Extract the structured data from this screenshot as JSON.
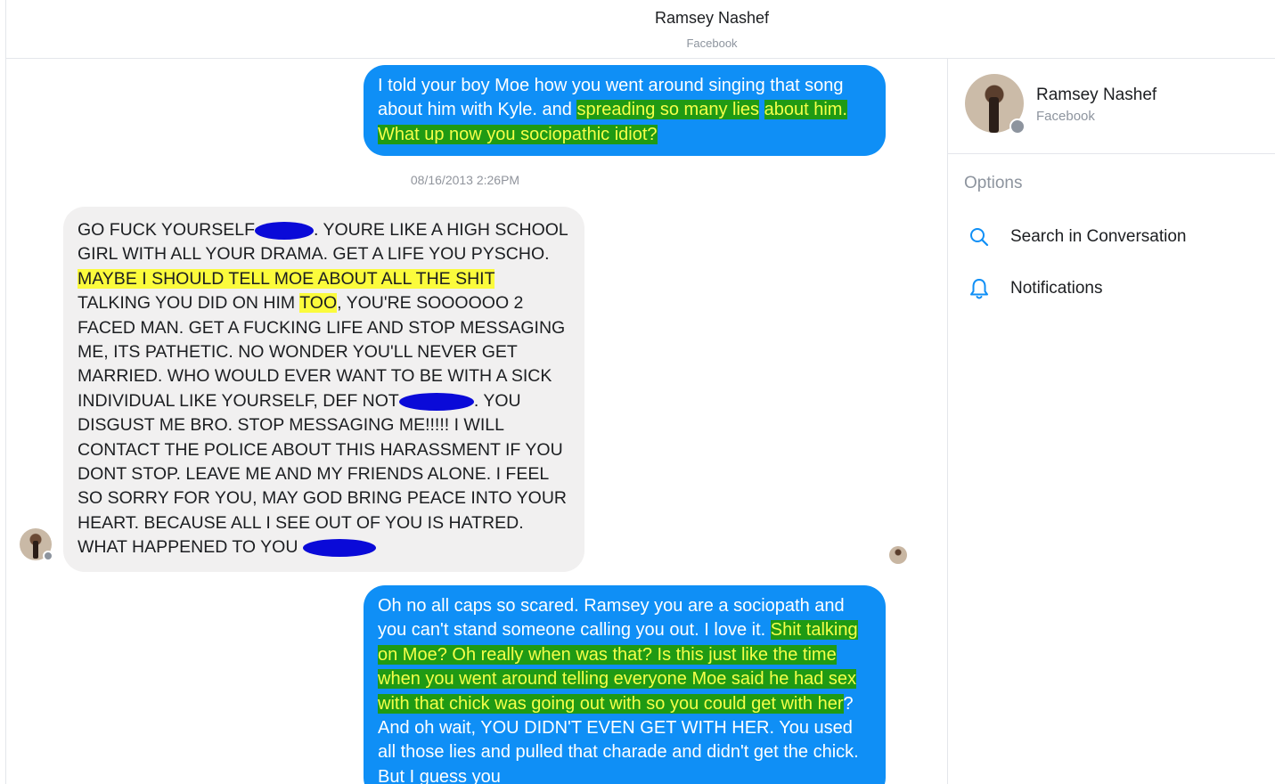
{
  "header": {
    "name": "Ramsey Nashef",
    "subtitle": "Facebook"
  },
  "messages": {
    "m1": {
      "p1": "I told your boy Moe how you went around singing that song about him with Kyle. and ",
      "p2": "spreading so many lies",
      "p3": "about him.  What up now you sociopathic idiot?"
    },
    "timestamp": "08/16/2013 2:26PM",
    "m2": {
      "p1": "GO FUCK YOURSELF",
      "p2": ". YOURE LIKE A HIGH SCHOOL GIRL WITH ALL YOUR DRAMA. GET A LIFE YOU PYSCHO.",
      "p3": "MAYBE I SHOULD TELL MOE ABOUT ALL THE SHIT",
      "p4": "TALKING YOU DID ON HIM ",
      "p5": "TOO",
      "p6": ", YOU'RE SOOOOOO 2 FACED MAN. GET A FUCKING LIFE AND STOP MESSAGING ME, ITS PATHETIC. NO WONDER YOU'LL NEVER GET MARRIED. WHO WOULD EVER WANT TO BE WITH A SICK INDIVIDUAL LIKE YOURSELF, DEF NOT",
      "p7": ". YOU DISGUST ME BRO. STOP MESSAGING ME!!!!! I WILL CONTACT THE POLICE ABOUT THIS HARASSMENT IF YOU DONT STOP. LEAVE ME AND MY FRIENDS ALONE. I FEEL SO SORRY FOR YOU, MAY GOD BRING PEACE INTO YOUR HEART. BECAUSE ALL I SEE OUT OF YOU IS HATRED. WHAT HAPPENED TO YOU "
    },
    "m3": {
      "p1": "Oh no all caps so scared.  Ramsey you are a sociopath and you can't stand someone calling you out.  I love it. ",
      "p2": "Shit talking on Moe?  Oh really when was that?  Is this just like the time when you went around telling everyone Moe said he had sex with that chick was going out with so you could get with her",
      "p3": "?  And oh wait, YOU DIDN'T EVEN GET WITH HER.  You used all those lies and pulled that charade and didn't get the chick.  But I guess you"
    }
  },
  "sidebar": {
    "name": "Ramsey Nashef",
    "subtitle": "Facebook",
    "options_label": "Options",
    "search_label": "Search in Conversation",
    "notifications_label": "Notifications",
    "accent_color": "#0f8ff6"
  },
  "icons": {
    "search": "search-icon",
    "notifications": "bell-icon",
    "facebook_badge": "facebook-badge-icon"
  }
}
